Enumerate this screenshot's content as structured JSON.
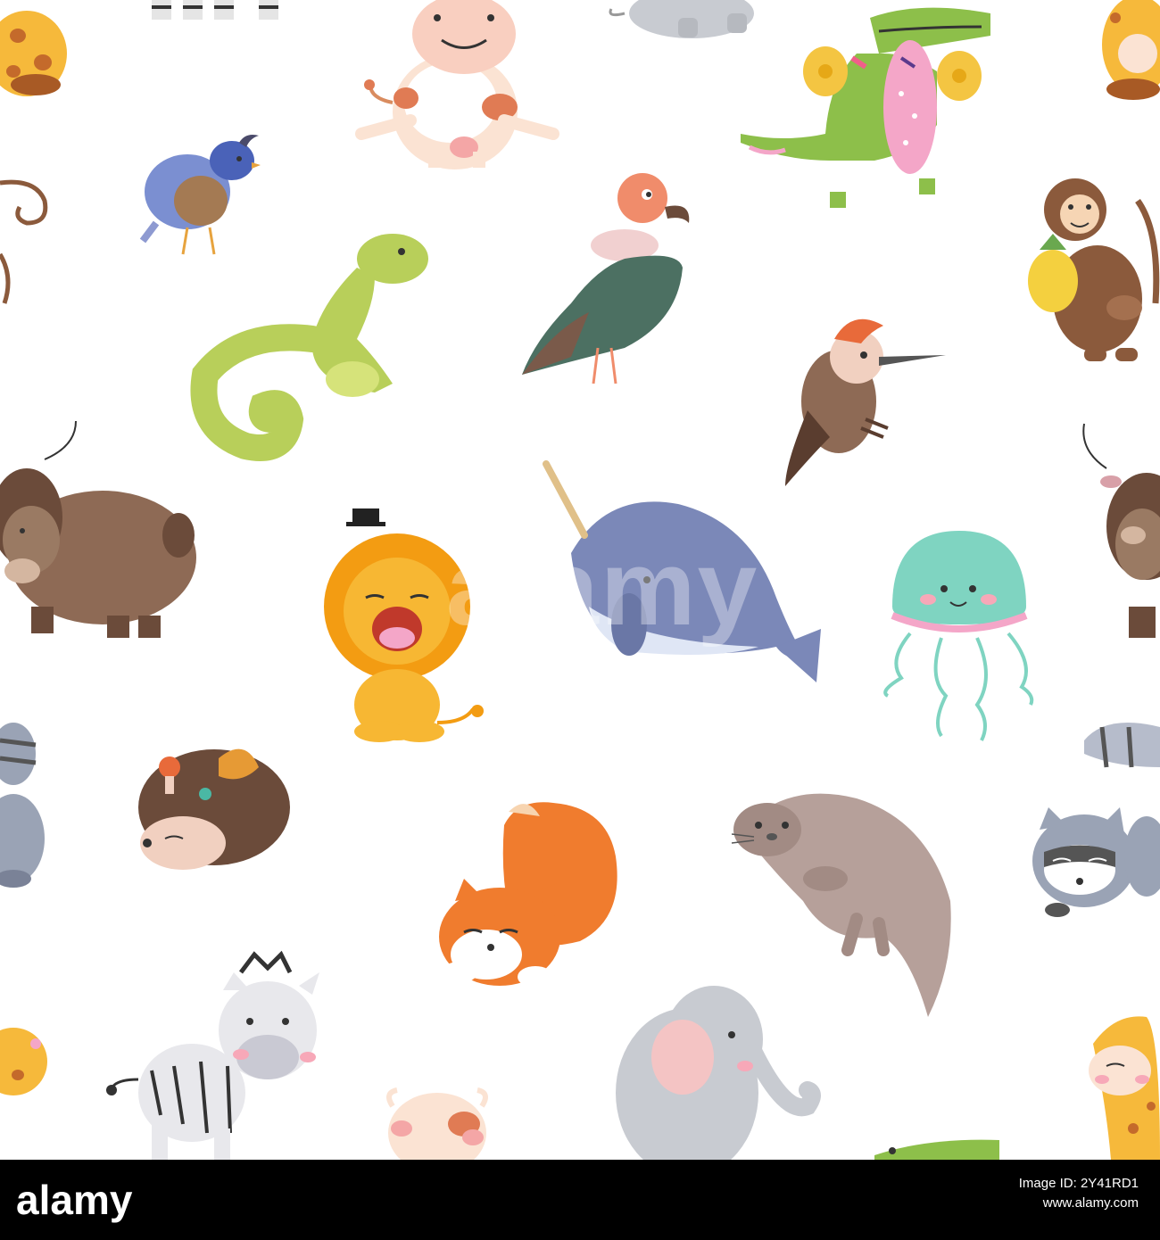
{
  "image": {
    "description_colors": {
      "background": "#ffffff",
      "footer": "#000000"
    },
    "animals": [
      "zebra-top-cropped",
      "giraffe-top-left",
      "cow-sitting",
      "elephant-top-cropped",
      "crocodile-with-cymbals",
      "giraffe-top-right",
      "quail",
      "monkey-tail-left",
      "vulture",
      "monkey-with-pineapple",
      "iguana",
      "woodpecker",
      "yak",
      "lion",
      "narwhal",
      "jellyfish",
      "yak-right",
      "raccoon-left",
      "hedgehog",
      "fox",
      "otter",
      "raccoon-right",
      "zebra",
      "giraffe-bottom-left",
      "cow-head",
      "elephant",
      "crocodile-bottom",
      "giraffe-bottom-right"
    ]
  },
  "watermark": {
    "text": "alamy",
    "color": "rgba(255,255,255,0.35)"
  },
  "footer": {
    "logo": "alamy",
    "image_id_line": "Image ID: 2Y41RD1",
    "site_line": "www.alamy.com"
  }
}
